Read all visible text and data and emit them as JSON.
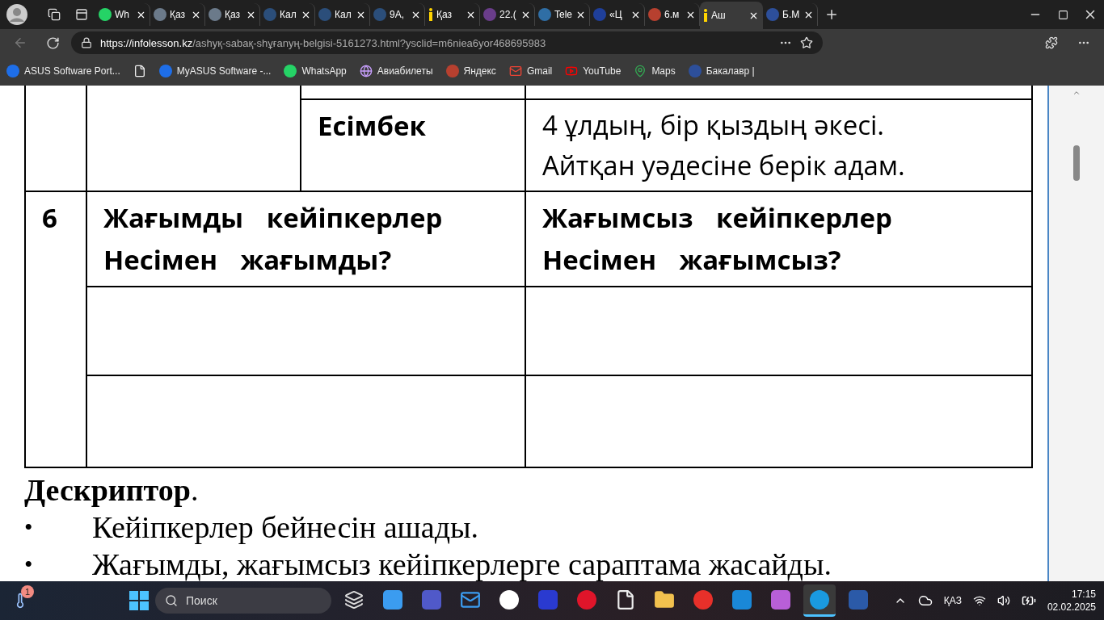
{
  "browser": {
    "tabs": [
      {
        "title": "Wh",
        "kind": "whatsapp",
        "selected": false
      },
      {
        "title": "Қаз",
        "kind": "books",
        "selected": false
      },
      {
        "title": "Қаз",
        "kind": "books",
        "selected": false
      },
      {
        "title": "Кал",
        "kind": "hand",
        "selected": false
      },
      {
        "title": "Кал",
        "kind": "hand",
        "selected": false
      },
      {
        "title": "9А,",
        "kind": "hand",
        "selected": false
      },
      {
        "title": "Қаз",
        "kind": "info",
        "selected": false
      },
      {
        "title": "22.(",
        "kind": "presentation",
        "selected": false
      },
      {
        "title": "Tele",
        "kind": "telegram",
        "selected": false
      },
      {
        "title": "«Ц",
        "kind": "brand",
        "selected": false
      },
      {
        "title": "6.м",
        "kind": "yandex",
        "selected": false
      },
      {
        "title": "Аш",
        "kind": "info",
        "selected": true
      },
      {
        "title": "Б.М",
        "kind": "letter",
        "selected": false
      }
    ],
    "url": {
      "host": "https://infolesson.kz",
      "path": "/ashyқ-sabaқ-shұғanyң-belgisi-5161273.html?ysclid=m6niea6yor468695983"
    },
    "bookmarks": [
      {
        "label": "ASUS Software Port...",
        "kind": "asus"
      },
      {
        "kind": "page"
      },
      {
        "label": "MyASUS Software -...",
        "kind": "asus"
      },
      {
        "label": "WhatsApp",
        "kind": "whatsapp"
      },
      {
        "label": "Авиабилеты",
        "kind": "globe"
      },
      {
        "label": "Яндекс",
        "kind": "yandex"
      },
      {
        "label": "Gmail",
        "kind": "gmail"
      },
      {
        "label": "YouTube",
        "kind": "youtube"
      },
      {
        "label": "Maps",
        "kind": "maps"
      },
      {
        "label": "Бакалавр |",
        "kind": "letter"
      }
    ]
  },
  "table": {
    "name_cell": "Есімбек",
    "description_lines": [
      "4 ұлдың, бір қыздың әкесі.",
      "Айтқан уәдесіне берік адам."
    ],
    "row_number": "6",
    "positive_header": "Жағымды кейіпкерлер Несімен жағымды?",
    "negative_header": "Жағымсыз кейіпкерлер Несімен жағымсыз?"
  },
  "descriptor": {
    "title": "**Дескриптор**.",
    "items": [
      {
        "marker": "•",
        "text": "Кейіпкерлер бейнесін ашады."
      },
      {
        "marker": "•",
        "text": "Жағымды, жағымсыз кейіпкерлерге сараптама жасайды."
      }
    ]
  },
  "taskbar": {
    "weather_badge": "1",
    "search_placeholder": "Поиск",
    "apps": [
      {
        "kind": "taskview",
        "active": false
      },
      {
        "kind": "copilot",
        "active": false
      },
      {
        "kind": "teams",
        "active": false
      },
      {
        "kind": "mail",
        "active": false
      },
      {
        "kind": "yandex_browser",
        "active": false
      },
      {
        "kind": "app",
        "active": false
      },
      {
        "kind": "opera",
        "active": false
      },
      {
        "kind": "file",
        "active": false
      },
      {
        "kind": "folder",
        "active": false
      },
      {
        "kind": "yandex",
        "active": false
      },
      {
        "kind": "store",
        "active": false
      },
      {
        "kind": "m365",
        "active": false
      },
      {
        "kind": "edge",
        "active": true
      },
      {
        "kind": "word",
        "active": false
      }
    ],
    "language": "ҚАЗ",
    "time": "17:15",
    "date": "02.02.2025"
  }
}
